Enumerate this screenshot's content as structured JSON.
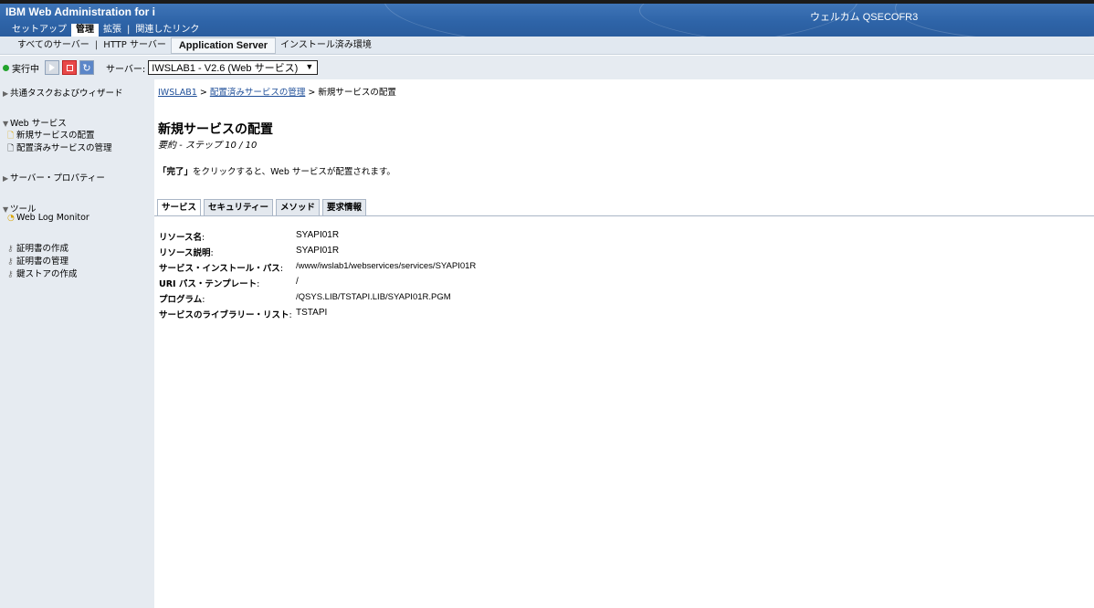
{
  "app": {
    "title": "IBM Web Administration for i",
    "welcome": "ウェルカム QSECOFR3"
  },
  "topnav": [
    {
      "label": "セットアップ",
      "active": false
    },
    {
      "label": "管理",
      "active": true
    },
    {
      "label": "拡張",
      "active": false
    },
    {
      "label": "関連したリンク",
      "active": false
    }
  ],
  "subnav": [
    {
      "label": "すべてのサーバー",
      "active": false
    },
    {
      "label": "HTTP サーバー",
      "active": false
    },
    {
      "label": "Application Server",
      "active": true
    },
    {
      "label": "インストール済み環境",
      "active": false
    }
  ],
  "status": {
    "state": "実行中",
    "server_label": "サーバー:",
    "server_value": "IWSLAB1 - V2.6 (Web サービス)",
    "colors": {
      "running": "#22a32c",
      "stop": "#e84848",
      "refresh": "#5b86c8"
    }
  },
  "sidebar": {
    "sections": [
      {
        "label": "共通タスクおよびウィザード",
        "expanded": false,
        "items": []
      },
      {
        "label": "Web サービス",
        "expanded": true,
        "items": [
          {
            "label": "新規サービスの配置",
            "icon": "new-page-icon"
          },
          {
            "label": "配置済みサービスの管理",
            "icon": "page-icon"
          }
        ]
      },
      {
        "label": "サーバー・プロパティー",
        "expanded": false,
        "items": []
      },
      {
        "label": "ツール",
        "expanded": true,
        "items": [
          {
            "label": "Web Log Monitor",
            "icon": "monitor-icon"
          }
        ]
      }
    ],
    "extra_items": [
      {
        "label": "証明書の作成",
        "icon": "key-icon"
      },
      {
        "label": "証明書の管理",
        "icon": "key-icon"
      },
      {
        "label": "鍵ストアの作成",
        "icon": "key-icon"
      }
    ]
  },
  "main": {
    "breadcrumb": [
      {
        "label": "IWSLAB1",
        "link": true
      },
      {
        "label": "配置済みサービスの管理",
        "link": true
      },
      {
        "label": "新規サービスの配置",
        "link": false
      }
    ],
    "breadcrumb_sep": ">",
    "title": "新規サービスの配置",
    "step": "要約 - ステップ 10 / 10",
    "instruction_bold": "「完了」",
    "instruction_rest": "をクリックすると、Web サービスが配置されます。",
    "tabs": [
      {
        "label": "サービス",
        "active": true
      },
      {
        "label": "セキュリティー",
        "active": false
      },
      {
        "label": "メソッド",
        "active": false
      },
      {
        "label": "要求情報",
        "active": false
      }
    ],
    "details": [
      {
        "label": "リソース名",
        "colon": ":",
        "value": "SYAPI01R"
      },
      {
        "label": "リソース説明",
        "colon": ":",
        "value": "SYAPI01R"
      },
      {
        "label": "サービス・インストール・パス",
        "colon": ":",
        "value": "/www/iwslab1/webservices/services/SYAPI01R"
      },
      {
        "label": "URI パス・テンプレート",
        "colon": ":",
        "value": "/"
      },
      {
        "label": "プログラム",
        "colon": ":",
        "value": "/QSYS.LIB/TSTAPI.LIB/SYAPI01R.PGM"
      },
      {
        "label": "サービスのライブラリー・リスト",
        "colon": ":",
        "value": "TSTAPI"
      }
    ]
  }
}
